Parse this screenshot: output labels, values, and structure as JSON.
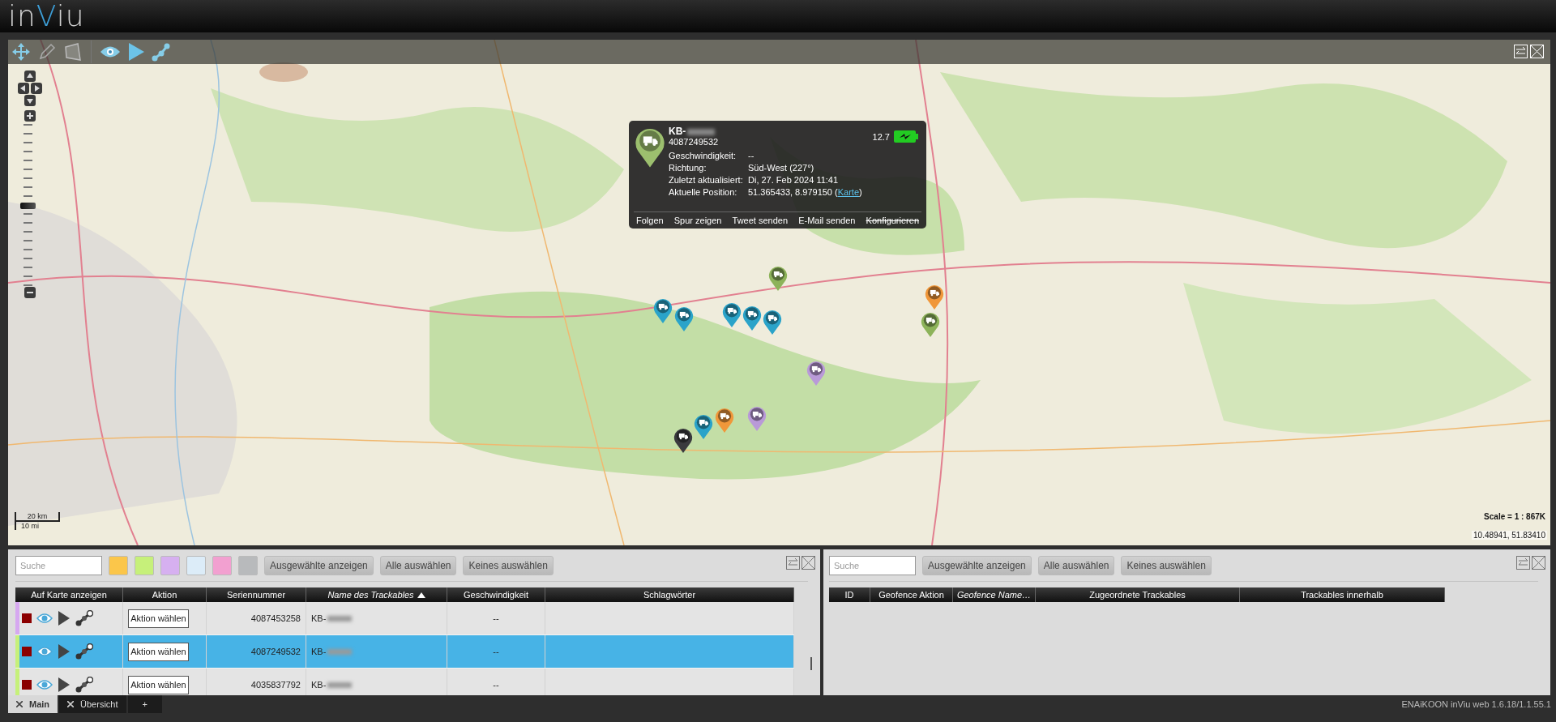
{
  "header": {
    "logo": [
      {
        "text": "in",
        "accent": false
      },
      {
        "text": "V",
        "accent": true
      },
      {
        "text": "iu",
        "accent": false
      }
    ]
  },
  "map": {
    "zoom_slider": {
      "level": 0.49
    },
    "markers": [
      {
        "color": "#8db35a"
      },
      {
        "color": "#2aa3c9"
      },
      {
        "color": "#2aa3c9"
      },
      {
        "color": "#2aa3c9"
      },
      {
        "color": "#2aa3c9"
      },
      {
        "color": "#2aa3c9"
      },
      {
        "color": "#f0973a"
      },
      {
        "color": "#8db35a"
      },
      {
        "color": "#b99ad8"
      },
      {
        "color": "#2aa3c9"
      },
      {
        "color": "#f0973a"
      },
      {
        "color": "#b99ad8"
      },
      {
        "color": "#3a3a3e"
      }
    ],
    "popup": {
      "title": "KB-",
      "serial": "4087249532",
      "battery": "12.7",
      "fields": [
        {
          "label": "Geschwindigkeit:",
          "value": "--"
        },
        {
          "label": "Richtung:",
          "value": "Süd-West (227°)"
        },
        {
          "label": "Zuletzt aktualisiert:",
          "value": "Di, 27. Feb 2024 11:41"
        },
        {
          "label": "Aktuelle Position:",
          "value": "51.365433, 8.979150 (",
          "link": "Karte",
          "after": ")"
        }
      ],
      "actions": [
        {
          "label": "Folgen",
          "disabled": false
        },
        {
          "label": "Spur zeigen",
          "disabled": false
        },
        {
          "label": "Tweet senden",
          "disabled": false
        },
        {
          "label": "E-Mail senden",
          "disabled": false
        },
        {
          "label": "Konfigurieren",
          "disabled": true
        }
      ]
    },
    "scale_bar": {
      "top": "20 km",
      "bottom": "10 mi"
    },
    "scale": "Scale = 1 : 867K",
    "coordinates": "10.48941, 51.83410"
  },
  "trackables": {
    "search": {
      "placeholder": "Suche"
    },
    "color_filters": [
      {
        "color": "#fbc64a"
      },
      {
        "color": "#c6f07a"
      },
      {
        "color": "#d6b0f0"
      },
      {
        "color": "#dcecf8"
      },
      {
        "color": "#f2a0d0"
      },
      {
        "color": "#b8babc"
      }
    ],
    "buttons": [
      "Ausgewählte anzeigen",
      "Alle auswählen",
      "Keines auswählen"
    ],
    "columns": [
      {
        "label": "Auf Karte anzeigen",
        "italic": false,
        "sorted": false
      },
      {
        "label": "Aktion",
        "italic": false,
        "sorted": false
      },
      {
        "label": "Seriennummer",
        "italic": false,
        "sorted": false
      },
      {
        "label": "Name des Trackables",
        "italic": true,
        "sorted": true
      },
      {
        "label": "Geschwindigkeit",
        "italic": false,
        "sorted": false
      },
      {
        "label": "Schlagwörter",
        "italic": false,
        "sorted": false
      }
    ],
    "rows": [
      {
        "color": "#d6a8f0",
        "selected": false,
        "action": "Aktion wählen",
        "serial": "4087453258",
        "name": "KB-",
        "speed": "--"
      },
      {
        "color": "#c6f07a",
        "selected": true,
        "action": "Aktion wählen",
        "serial": "4087249532",
        "name": "KB-",
        "speed": "--"
      },
      {
        "color": "#c6f07a",
        "selected": false,
        "action": "Aktion wählen",
        "serial": "4035837792",
        "name": "KB-",
        "speed": "--"
      }
    ]
  },
  "geofences": {
    "search": {
      "placeholder": "Suche"
    },
    "buttons": [
      "Ausgewählte anzeigen",
      "Alle auswählen",
      "Keines auswählen"
    ],
    "columns": [
      {
        "label": "ID",
        "italic": false
      },
      {
        "label": "Geofence Aktion",
        "italic": false
      },
      {
        "label": "Geofence Name…",
        "italic": true
      },
      {
        "label": "Zugeordnete Trackables",
        "italic": false
      },
      {
        "label": "Trackables innerhalb",
        "italic": false
      }
    ]
  },
  "footer": {
    "tabs": [
      {
        "label": "Main",
        "selected": true,
        "closable": true
      },
      {
        "label": "Übersicht",
        "selected": false,
        "closable": true
      },
      {
        "label": "+",
        "selected": false,
        "closable": false
      }
    ],
    "version": "ENAiKOON inViu web 1.6.18/1.1.55.1"
  }
}
